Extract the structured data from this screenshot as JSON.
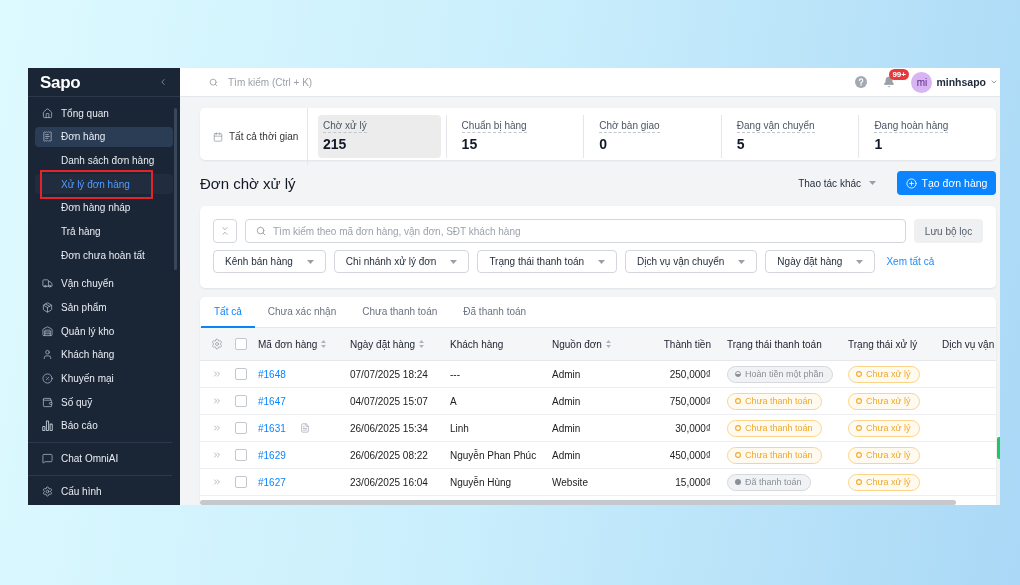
{
  "sidebar": {
    "logo": "Sapo",
    "sections": [
      {
        "items": [
          {
            "label": "Tổng quan",
            "selected": false
          },
          {
            "label": "Đơn hàng",
            "selected": true,
            "children": [
              {
                "label": "Danh sách đơn hàng",
                "selected": false,
                "highlighted": false
              },
              {
                "label": "Xử lý đơn hàng",
                "selected": true,
                "highlighted": true
              },
              {
                "label": "Đơn hàng nháp",
                "selected": false,
                "highlighted": false
              },
              {
                "label": "Trả hàng",
                "selected": false,
                "highlighted": false
              },
              {
                "label": "Đơn chưa hoàn tất",
                "selected": false,
                "highlighted": false
              }
            ]
          },
          {
            "label": "Vận chuyển",
            "selected": false
          },
          {
            "label": "Sản phẩm",
            "selected": false
          },
          {
            "label": "Quản lý kho",
            "selected": false
          },
          {
            "label": "Khách hàng",
            "selected": false
          },
          {
            "label": "Khuyến mại",
            "selected": false
          },
          {
            "label": "Số quỹ",
            "selected": false
          },
          {
            "label": "Báo cáo",
            "selected": false
          }
        ]
      },
      {
        "items": [
          {
            "label": "Chat OmniAI",
            "selected": false
          }
        ]
      },
      {
        "items": [
          {
            "label": "Cấu hình",
            "selected": false
          }
        ]
      }
    ]
  },
  "topbar": {
    "search_placeholder": "Tìm kiếm (Ctrl + K)",
    "notification_count": "99+",
    "user": {
      "initials": "mi",
      "name": "minhsapo"
    }
  },
  "summary": {
    "time_range": "Tất cả thời gian",
    "statuses": [
      {
        "label": "Chờ xử lý",
        "value": "215",
        "selected": true
      },
      {
        "label": "Chuẩn bị hàng",
        "value": "15",
        "selected": false
      },
      {
        "label": "Chờ bàn giao",
        "value": "0",
        "selected": false
      },
      {
        "label": "Đang vận chuyển",
        "value": "5",
        "selected": false
      },
      {
        "label": "Đang hoàn hàng",
        "value": "1",
        "selected": false
      }
    ]
  },
  "page": {
    "title": "Đơn chờ xử lý",
    "more_actions": "Thao tác khác",
    "create_button": "Tạo đơn hàng"
  },
  "filters": {
    "search_placeholder": "Tìm kiếm theo mã đơn hàng, vận đơn, SĐT khách hàng",
    "save_button": "Lưu bộ lọc",
    "dropdowns": [
      "Kênh bán hàng",
      "Chi nhánh xử lý đơn",
      "Trạng thái thanh toán",
      "Dịch vụ vận chuyển",
      "Ngày đặt hàng"
    ],
    "see_all": "Xem tất cả"
  },
  "table": {
    "tabs": [
      {
        "label": "Tất cả",
        "selected": true
      },
      {
        "label": "Chưa xác nhận",
        "selected": false
      },
      {
        "label": "Chưa thanh toán",
        "selected": false
      },
      {
        "label": "Đã thanh toán",
        "selected": false
      }
    ],
    "select_all_checked": false,
    "columns": [
      {
        "label": "Mã đơn hàng",
        "sortable": true
      },
      {
        "label": "Ngày đặt hàng",
        "sortable": true
      },
      {
        "label": "Khách hàng",
        "sortable": false
      },
      {
        "label": "Nguồn đơn",
        "sortable": true
      },
      {
        "label": "Thành tiền",
        "sortable": false
      },
      {
        "label": "Trạng thái thanh toán",
        "sortable": false
      },
      {
        "label": "Trạng thái xử lý",
        "sortable": false
      },
      {
        "label": "Dịch vụ vận",
        "sortable": false
      }
    ],
    "rows": [
      {
        "checked": false,
        "code": "#1648",
        "has_note": false,
        "date": "07/07/2025 18:24",
        "customer": "---",
        "source": "Admin",
        "total": "250,000₫",
        "payment": {
          "label": "Hoàn tiền một phần",
          "kind": "partial_refund"
        },
        "processing": {
          "label": "Chưa xử lý",
          "kind": "pending"
        }
      },
      {
        "checked": false,
        "code": "#1647",
        "has_note": false,
        "date": "04/07/2025 15:07",
        "customer": "A",
        "source": "Admin",
        "total": "750,000₫",
        "payment": {
          "label": "Chưa thanh toán",
          "kind": "unpaid"
        },
        "processing": {
          "label": "Chưa xử lý",
          "kind": "pending"
        }
      },
      {
        "checked": false,
        "code": "#1631",
        "has_note": true,
        "date": "26/06/2025 15:34",
        "customer": "Linh",
        "source": "Admin",
        "total": "30,000₫",
        "payment": {
          "label": "Chưa thanh toán",
          "kind": "unpaid"
        },
        "processing": {
          "label": "Chưa xử lý",
          "kind": "pending"
        }
      },
      {
        "checked": false,
        "code": "#1629",
        "has_note": false,
        "date": "26/06/2025 08:22",
        "customer": "Nguyễn Phan Phúc",
        "source": "Admin",
        "total": "450,000₫",
        "payment": {
          "label": "Chưa thanh toán",
          "kind": "unpaid"
        },
        "processing": {
          "label": "Chưa xử lý",
          "kind": "pending"
        }
      },
      {
        "checked": false,
        "code": "#1627",
        "has_note": false,
        "date": "23/06/2025 16:04",
        "customer": "Nguyễn Hùng",
        "source": "Website",
        "total": "15,000₫",
        "payment": {
          "label": "Đã thanh toán",
          "kind": "paid"
        },
        "processing": {
          "label": "Chưa xử lý",
          "kind": "pending"
        }
      }
    ]
  }
}
